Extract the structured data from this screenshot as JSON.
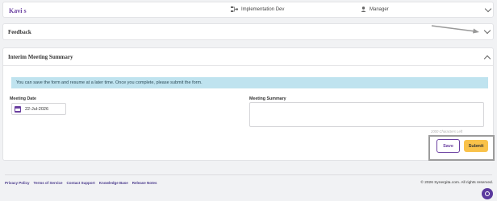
{
  "topbar": {
    "user_name": "Kavi s",
    "department": "Implementation Dev",
    "role": "Manager"
  },
  "feedback": {
    "title": "Feedback"
  },
  "interim": {
    "title": "Interim Meeting Summary",
    "info_message": "You can save the form and resume at a later time. Once you complete, please submit the form.",
    "meeting_date_label": "Meeting Date",
    "meeting_date_value": "22-Jul-2026",
    "meeting_summary_label": "Meeting Summary",
    "chars_left": "2000 Characters Left",
    "save_label": "Save",
    "submit_label": "Submit"
  },
  "footer": {
    "links": [
      "Privacy Policy",
      "Terms of Service",
      "Contact Support",
      "Knowledge Base",
      "Release Notes"
    ],
    "copyright": "© 2026 Synergita.com. All rights reserved."
  },
  "colors": {
    "brand": "#6a3fa0",
    "info_bg": "#bfe3ef",
    "submit_bg": "#f9c24a",
    "highlight_border": "#9c9c9c"
  },
  "icons": {
    "department": "org-chart-icon",
    "role": "person-icon",
    "date": "calendar-icon",
    "collapse": "chevron-icon",
    "help": "help-chat-icon"
  }
}
